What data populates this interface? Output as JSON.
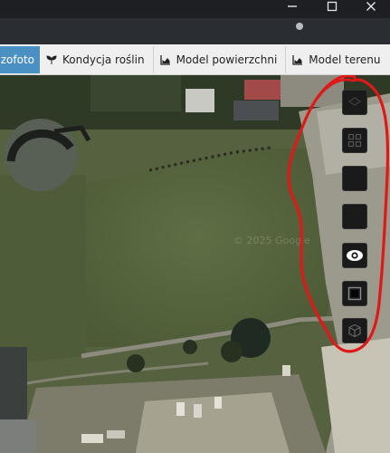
{
  "window": {
    "close_symbol": "✕",
    "maximize_symbol": "☐"
  },
  "tabs": [
    {
      "label": "zofoto",
      "icon": "orthophoto-icon",
      "active": true
    },
    {
      "label": "Kondycja roślin",
      "icon": "sprout-icon",
      "active": false
    },
    {
      "label": "Model powierzchni",
      "icon": "area-chart-icon",
      "active": false
    },
    {
      "label": "Model terenu",
      "icon": "area-chart-icon",
      "active": false
    }
  ],
  "map": {
    "attribution": "© 2025 Google",
    "tools": [
      {
        "name": "layers-tool-button",
        "icon": "layers-icon"
      },
      {
        "name": "grid-tool-button",
        "icon": "grid-icon"
      },
      {
        "name": "blank-tool-button-1",
        "icon": ""
      },
      {
        "name": "blank-tool-button-2",
        "icon": ""
      },
      {
        "name": "visibility-tool-button",
        "icon": "eye-icon"
      },
      {
        "name": "frame-tool-button",
        "icon": "square-frame-icon"
      },
      {
        "name": "cube-tool-button",
        "icon": "cube-icon"
      }
    ]
  },
  "colors": {
    "tab_active": "#4a90c2",
    "annotation_red": "#e01818",
    "grass": "#5c6b43"
  }
}
